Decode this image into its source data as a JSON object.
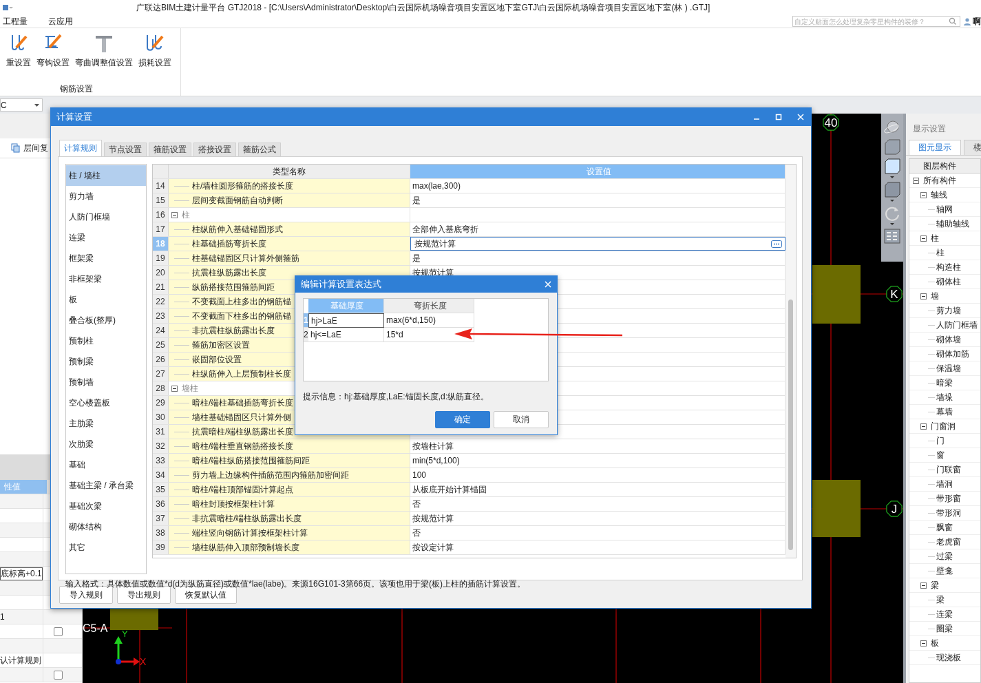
{
  "window": {
    "title": "广联达BIM土建计量平台 GTJ2018 - [C:\\Users\\Administrator\\Desktop\\白云国际机场噪音项目安置区地下室GTJ\\白云国际机场噪音项目安置区地下室(林 ) .GTJ]"
  },
  "menu": [
    {
      "label": "工程量"
    },
    {
      "label": "云应用"
    }
  ],
  "search": {
    "placeholder": "自定义贴面怎么处理复杂零星构件的装修？"
  },
  "user": "啊",
  "ribbon": {
    "buttons": [
      {
        "label": "重设置",
        "kind": "hook"
      },
      {
        "label": "弯钩设置",
        "kind": "hook2"
      },
      {
        "label": "弯曲调整值设置",
        "kind": "tee"
      },
      {
        "label": "损耗设置",
        "kind": "bend"
      }
    ],
    "group": "钢筋设置"
  },
  "floor_select": {
    "value": "C"
  },
  "left_panel": {
    "tool": "层间复",
    "header": "性值",
    "rows": [
      {
        "kind": "field",
        "value": "底标高+0.1"
      },
      {
        "kind": "text",
        "value": "1"
      },
      {
        "kind": "checkbox",
        "checked": false
      },
      {
        "kind": "text",
        "value": "认计算规则"
      },
      {
        "kind": "checkbox",
        "checked": false
      }
    ]
  },
  "canvas": {
    "axis_labels": [
      {
        "label": "40"
      },
      {
        "label": "K"
      },
      {
        "label": "J"
      }
    ],
    "column_label": "C5-A",
    "y_axis": "Y",
    "x_axis": "X"
  },
  "right_panel": {
    "title": "显示设置",
    "tabs": [
      {
        "label": "图元显示",
        "selected": true
      },
      {
        "label": "楼",
        "selected": false
      }
    ],
    "header": "图层构件",
    "tree": [
      {
        "label": "所有构件",
        "expanded": true,
        "children": [
          {
            "label": "轴线",
            "expanded": true,
            "children": [
              {
                "label": "轴网"
              },
              {
                "label": "辅助轴线"
              }
            ]
          },
          {
            "label": "柱",
            "expanded": true,
            "children": [
              {
                "label": "柱"
              },
              {
                "label": "构造柱"
              },
              {
                "label": "砌体柱"
              }
            ]
          },
          {
            "label": "墙",
            "expanded": true,
            "children": [
              {
                "label": "剪力墙"
              },
              {
                "label": "人防门框墙"
              },
              {
                "label": "砌体墙"
              },
              {
                "label": "砌体加筋"
              },
              {
                "label": "保温墙"
              },
              {
                "label": "暗梁"
              },
              {
                "label": "墙垛"
              },
              {
                "label": "幕墙"
              }
            ]
          },
          {
            "label": "门窗洞",
            "expanded": true,
            "children": [
              {
                "label": "门"
              },
              {
                "label": "窗"
              },
              {
                "label": "门联窗"
              },
              {
                "label": "墙洞"
              },
              {
                "label": "带形窗"
              },
              {
                "label": "带形洞"
              },
              {
                "label": "飘窗"
              },
              {
                "label": "老虎窗"
              },
              {
                "label": "过梁"
              },
              {
                "label": "壁龛"
              }
            ]
          },
          {
            "label": "梁",
            "expanded": true,
            "children": [
              {
                "label": "梁"
              },
              {
                "label": "连梁"
              },
              {
                "label": "圈梁"
              }
            ]
          },
          {
            "label": "板",
            "expanded": true,
            "children": [
              {
                "label": "现浇板"
              }
            ]
          }
        ]
      }
    ]
  },
  "dialog": {
    "title": "计算设置",
    "tabs": [
      {
        "label": "计算规则",
        "selected": true
      },
      {
        "label": "节点设置",
        "selected": false
      },
      {
        "label": "箍筋设置",
        "selected": false
      },
      {
        "label": "搭接设置",
        "selected": false
      },
      {
        "label": "箍筋公式",
        "selected": false
      }
    ],
    "categories": [
      {
        "label": "柱 / 墙柱",
        "selected": true
      },
      {
        "label": "剪力墙",
        "selected": false
      },
      {
        "label": "人防门框墙",
        "selected": false
      },
      {
        "label": "连梁",
        "selected": false
      },
      {
        "label": "框架梁",
        "selected": false
      },
      {
        "label": "非框架梁",
        "selected": false
      },
      {
        "label": "板",
        "selected": false
      },
      {
        "label": "叠合板(整厚)",
        "selected": false
      },
      {
        "label": "预制柱",
        "selected": false
      },
      {
        "label": "预制梁",
        "selected": false
      },
      {
        "label": "预制墙",
        "selected": false
      },
      {
        "label": "空心楼盖板",
        "selected": false
      },
      {
        "label": "主肋梁",
        "selected": false
      },
      {
        "label": "次肋梁",
        "selected": false
      },
      {
        "label": "基础",
        "selected": false
      },
      {
        "label": "基础主梁 / 承台梁",
        "selected": false
      },
      {
        "label": "基础次梁",
        "selected": false
      },
      {
        "label": "砌体结构",
        "selected": false
      },
      {
        "label": "其它",
        "selected": false
      }
    ],
    "columns": [
      "类型名称",
      "设置值"
    ],
    "rows": [
      {
        "no": "14",
        "name": "柱/墙柱圆形箍筋的搭接长度",
        "value": "max(lae,300)",
        "selected": false
      },
      {
        "no": "15",
        "name": "层间变截面钢筋自动判断",
        "value": "是",
        "selected": false
      },
      {
        "no": "16",
        "name": "柱",
        "kind": "group",
        "expanded": true,
        "selected": false,
        "children": [
          {
            "no": "17",
            "name": "柱纵筋伸入基础锚固形式",
            "value": "全部伸入基底弯折",
            "selected": false
          },
          {
            "no": "18",
            "name": "柱基础插筋弯折长度",
            "value": "按规范计算",
            "selected": true
          },
          {
            "no": "19",
            "name": "柱基础锚固区只计算外侧箍筋",
            "value": "是",
            "selected": false
          },
          {
            "no": "20",
            "name": "抗震柱纵筋露出长度",
            "value": "按规范计算",
            "selected": false
          },
          {
            "no": "21",
            "name": "纵筋搭接范围箍筋间距",
            "selected": false
          },
          {
            "no": "22",
            "name": "不变截面上柱多出的钢筋锚",
            "selected": false
          },
          {
            "no": "23",
            "name": "不变截面下柱多出的钢筋锚",
            "selected": false
          },
          {
            "no": "24",
            "name": "非抗震柱纵筋露出长度",
            "selected": false
          },
          {
            "no": "25",
            "name": "箍筋加密区设置",
            "selected": false
          },
          {
            "no": "26",
            "name": "嵌固部位设置",
            "selected": false
          },
          {
            "no": "27",
            "name": "柱纵筋伸入上层预制柱长度",
            "selected": false
          }
        ]
      },
      {
        "no": "28",
        "name": "墙柱",
        "kind": "group",
        "expanded": true,
        "selected": false,
        "children": [
          {
            "no": "29",
            "name": "暗柱/端柱基础插筋弯折长度",
            "selected": false
          },
          {
            "no": "30",
            "name": "墙柱基础锚固区只计算外侧",
            "selected": false
          },
          {
            "no": "31",
            "name": "抗震暗柱/端柱纵筋露出长度",
            "selected": false
          },
          {
            "no": "32",
            "name": "暗柱/端柱垂直钢筋搭接长度",
            "value": "按墙柱计算",
            "selected": false
          },
          {
            "no": "33",
            "name": "暗柱/端柱纵筋搭接范围箍筋间距",
            "value": "min(5*d,100)",
            "selected": false
          },
          {
            "no": "34",
            "name": "剪力墙上边缘构件插筋范围内箍筋加密间距",
            "value": "100",
            "selected": false
          },
          {
            "no": "35",
            "name": "暗柱/端柱顶部锚固计算起点",
            "value": "从板底开始计算锚固",
            "selected": false
          },
          {
            "no": "36",
            "name": "暗柱封顶按框架柱计算",
            "value": "否",
            "selected": false
          },
          {
            "no": "37",
            "name": "非抗震暗柱/端柱纵筋露出长度",
            "value": "按规范计算",
            "selected": false
          },
          {
            "no": "38",
            "name": "端柱竖向钢筋计算按框架柱计算",
            "value": "否",
            "selected": false
          },
          {
            "no": "39",
            "name": "墙柱纵筋伸入顶部预制墙长度",
            "value": "按设定计算",
            "selected": false
          }
        ]
      }
    ],
    "hint": "输入格式：具体数值或数值*d(d为纵筋直径)或数值*lae(labe)。来源16G101-3第66页。该项也用于梁(板)上柱的插筋计算设置。",
    "buttons": [
      "导入规则",
      "导出规则",
      "恢复默认值"
    ]
  },
  "expr_dialog": {
    "title": "编辑计算设置表达式",
    "columns": [
      "基础厚度",
      "弯折长度"
    ],
    "rows": [
      {
        "no": "1",
        "condition": "hj>LaE",
        "value": "max(6*d,150)",
        "selected": true
      },
      {
        "no": "2",
        "condition": "hj<=LaE",
        "value": "15*d",
        "selected": false
      }
    ],
    "hint": "提示信息：hj:基础厚度,LaE:锚固长度,d:纵筋直径。",
    "buttons": [
      {
        "label": "确定",
        "primary": true
      },
      {
        "label": "取消",
        "primary": false
      }
    ]
  }
}
